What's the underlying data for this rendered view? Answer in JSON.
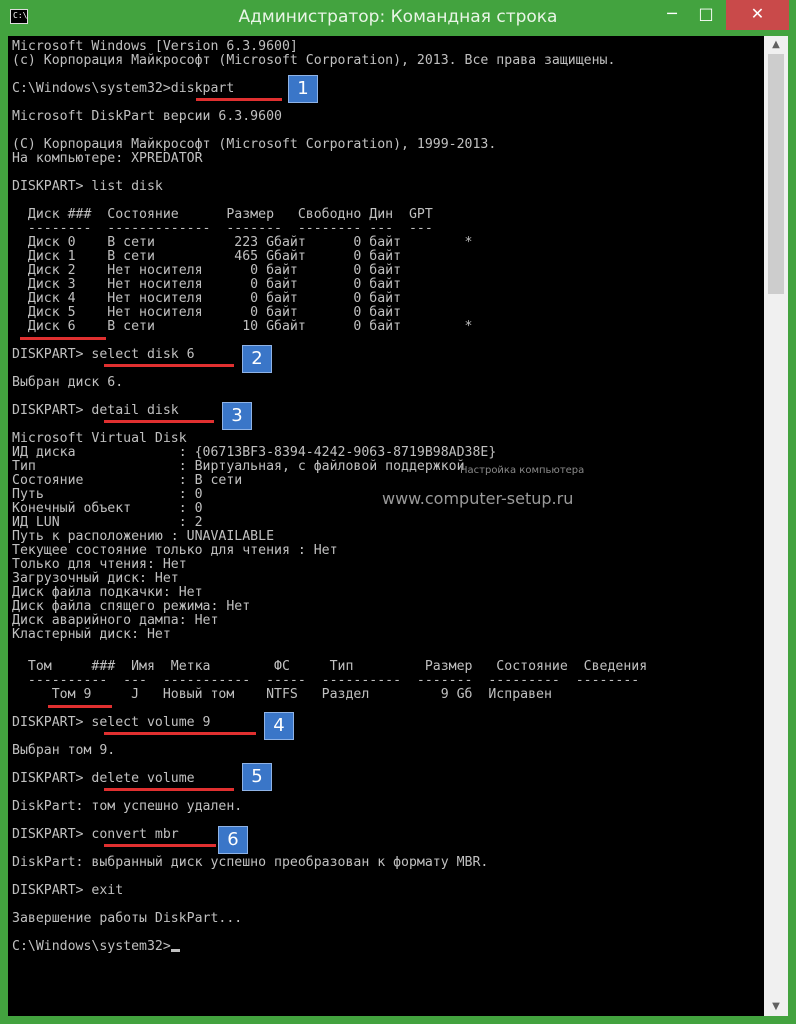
{
  "window": {
    "title": "Администратор: Командная строка",
    "icon_text": "C:\\",
    "controls": {
      "minimize": "─",
      "maximize": "□",
      "close": "✕"
    }
  },
  "console": {
    "header1": "Microsoft Windows [Version 6.3.9600]",
    "header2": "(c) Корпорация Майкрософт (Microsoft Corporation), 2013. Все права защищены.",
    "cmd1": "C:\\Windows\\system32>diskpart",
    "dp_version": "Microsoft DiskPart версии 6.3.9600",
    "dp_copyright": "(C) Корпорация Майкрософт (Microsoft Corporation), 1999-2013.",
    "dp_computer": "На компьютере: XPREDATOR",
    "cmd2": "DISKPART> list disk",
    "disk_header": "  Диск ###  Состояние      Размер   Свободно Дин  GPT",
    "disk_sep": "  --------  -------------  -------  -------- ---  ---",
    "disk_rows": [
      "  Диск 0    В сети          223 Gбайт      0 байт        *",
      "  Диск 1    В сети          465 Gбайт      0 байт",
      "  Диск 2    Нет носителя      0 байт       0 байт",
      "  Диск 3    Нет носителя      0 байт       0 байт",
      "  Диск 4    Нет носителя      0 байт       0 байт",
      "  Диск 5    Нет носителя      0 байт       0 байт",
      "  Диск 6    В сети           10 Gбайт      0 байт        *"
    ],
    "cmd3": "DISKPART> select disk 6",
    "res3": "Выбран диск 6.",
    "cmd4": "DISKPART> detail disk",
    "detail_lines": [
      "Microsoft Virtual Disk",
      "ИД диска             : {06713BF3-8394-4242-9063-8719B98AD38E}",
      "Тип                  : Виртуальная, с файловой поддержкой",
      "Состояние            : В сети",
      "Путь                 : 0",
      "Конечный объект      : 0",
      "ИД LUN               : 2",
      "Путь к расположению : UNAVAILABLE",
      "Текущее состояние только для чтения : Нет",
      "Только для чтения: Нет",
      "Загрузочный диск: Нет",
      "Диск файла подкачки: Нет",
      "Диск файла спящего режима: Нет",
      "Диск аварийного дампа: Нет",
      "Кластерный диск: Нет"
    ],
    "vol_header": "  Том     ###  Имя  Метка        ФС     Тип         Размер   Состояние  Сведения",
    "vol_sep": "  ----------  ---  -----------  -----  ----------  -------  ---------  --------",
    "vol_row": "     Том 9     J   Новый том    NTFS   Раздел         9 Gб  Исправен",
    "cmd5": "DISKPART> select volume 9",
    "res5": "Выбран том 9.",
    "cmd6": "DISKPART> delete volume",
    "res6": "DiskPart: том успешно удален.",
    "cmd7": "DISKPART> convert mbr",
    "res7": "DiskPart: выбранный диск успешно преобразован к формату MBR.",
    "cmd8": "DISKPART> exit",
    "res8": "Завершение работы DiskPart...",
    "prompt": "C:\\Windows\\system32>"
  },
  "badges": [
    "1",
    "2",
    "3",
    "4",
    "5",
    "6"
  ],
  "watermark": {
    "small": "Настройка компьютера",
    "large": "www.computer-setup.ru"
  },
  "colors": {
    "titlebar": "#43a33f",
    "console_bg": "#000000",
    "console_text": "#c0c0c0",
    "underline": "#e03030",
    "badge": "#3a76c8"
  }
}
